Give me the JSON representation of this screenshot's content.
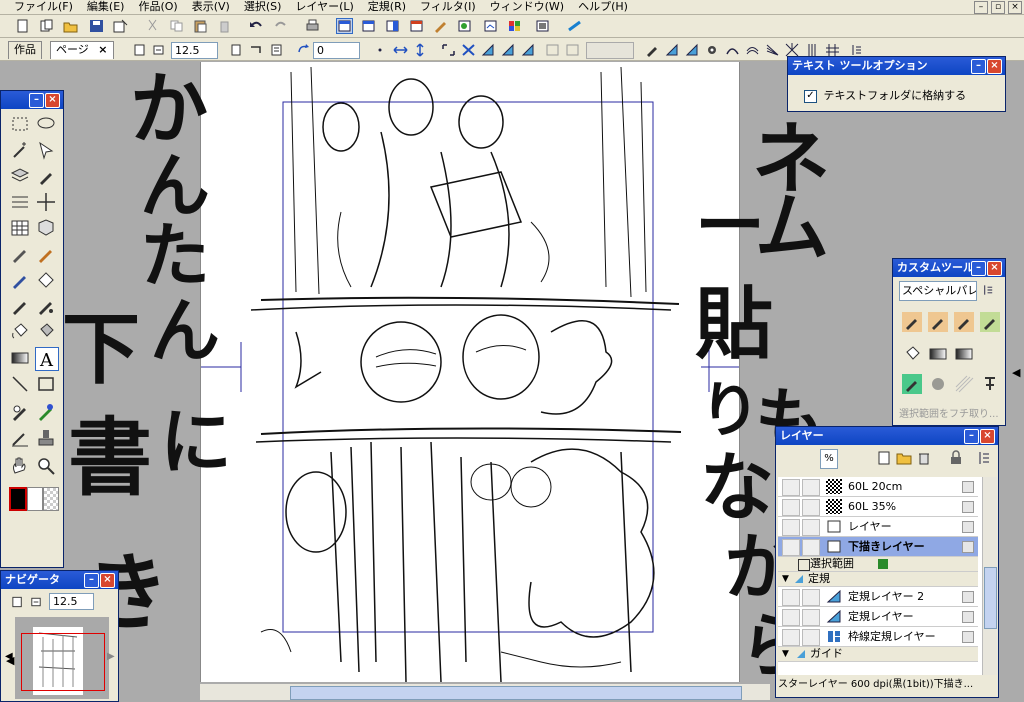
{
  "menu": [
    "ファイル(F)",
    "編集(E)",
    "作品(O)",
    "表示(V)",
    "選択(S)",
    "レイヤー(L)",
    "定規(R)",
    "フィルタ(I)",
    "ウィンドウ(W)",
    "ヘルプ(H)"
  ],
  "tabs": {
    "work": "作品",
    "page": "ページ",
    "close": "×"
  },
  "zoom_value": "12.5",
  "rotate_value": "0",
  "text_tool_options": {
    "title": "テキスト ツールオプション",
    "checkbox_label": "テキストフォルダに格納する",
    "checkbox_mark": "✓"
  },
  "custom_tools": {
    "title": "カスタムツール",
    "set_name": "スペシャルパレ...",
    "disabled_item": "選択範囲をフチ取り..."
  },
  "layers": {
    "title": "レイヤー",
    "top_value": "%",
    "rows": [
      {
        "name": "60L 20cm",
        "selected": false
      },
      {
        "name": "60L 35%",
        "selected": false
      },
      {
        "name": "レイヤー",
        "selected": false
      },
      {
        "name": "下描きレイヤー",
        "selected": true
      }
    ],
    "folder_selection": "選択範囲",
    "folder_ruler": "定規",
    "ruler_rows": [
      "定規レイヤー 2",
      "定規レイヤー",
      "枠線定規レイヤー"
    ],
    "folder_guide": "ガイド",
    "status": "スターレイヤー 600 dpi(黒(1bit))下描き..."
  },
  "navigator": {
    "title": "ナビゲータ",
    "zoom": "12.5"
  },
  "overlay_text": {
    "left": [
      "か",
      "ん",
      "た",
      "ん",
      "に",
      "下",
      "書",
      "き"
    ],
    "right": [
      "ネ",
      "ー",
      "ム",
      "貼",
      "り",
      "も",
      "な",
      "が",
      "ら"
    ]
  },
  "colors": {
    "titlebar": "#0e45c3",
    "selected_layer": "#8fa8e4",
    "main_color": "#cc0000"
  }
}
